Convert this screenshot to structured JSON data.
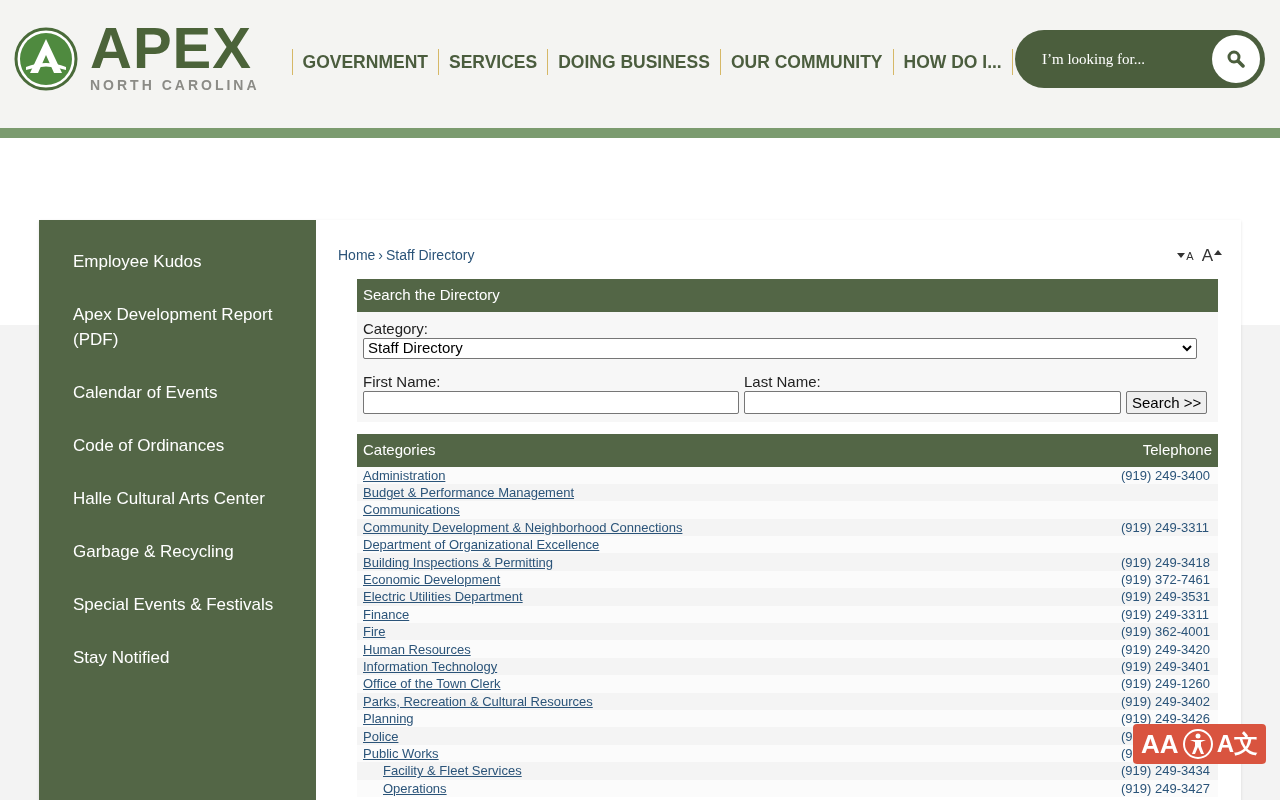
{
  "logo": {
    "name": "APEX",
    "subtitle": "NORTH CAROLINA"
  },
  "nav": [
    "GOVERNMENT",
    "SERVICES",
    "DOING BUSINESS",
    "OUR COMMUNITY",
    "HOW DO I..."
  ],
  "search": {
    "placeholder": "I’m looking for..."
  },
  "sidebar": {
    "items": [
      "Employee Kudos",
      "Apex Development Report (PDF)",
      "Calendar of Events",
      "Code of Ordinances",
      "Halle Cultural Arts Center",
      "Garbage & Recycling",
      "Special Events & Festivals",
      "Stay Notified"
    ]
  },
  "breadcrumb": {
    "items": [
      "Home",
      "Staff Directory"
    ],
    "separator": "›"
  },
  "font_size_controls": {
    "decrease": "A",
    "increase": "A"
  },
  "directory_search": {
    "title": "Search the Directory",
    "category_label": "Category:",
    "category_value": "Staff Directory",
    "first_name_label": "First Name:",
    "last_name_label": "Last Name:",
    "button": "Search >>"
  },
  "table": {
    "columns": [
      "Categories",
      "Telephone"
    ],
    "rows": [
      {
        "name": "Administration",
        "phone": "(919) 249-3400"
      },
      {
        "name": "Budget & Performance Management"
      },
      {
        "name": "Communications"
      },
      {
        "name": "Community Development & Neighborhood Connections",
        "phone": "(919) 249-3311"
      },
      {
        "name": "Department of Organizational Excellence"
      },
      {
        "name": "Building Inspections & Permitting",
        "phone": "(919) 249-3418"
      },
      {
        "name": "Economic Development",
        "phone": "(919) 372-7461"
      },
      {
        "name": "Electric Utilities Department",
        "phone": "(919) 249-3531"
      },
      {
        "name": "Finance",
        "phone": "(919) 249-3311"
      },
      {
        "name": "Fire",
        "phone": "(919) 362-4001"
      },
      {
        "name": "Human Resources",
        "phone": "(919) 249-3420"
      },
      {
        "name": "Information Technology",
        "phone": "(919) 249-3401"
      },
      {
        "name": "Office of the Town Clerk",
        "phone": "(919) 249-1260"
      },
      {
        "name": "Parks, Recreation & Cultural Resources",
        "phone": "(919) 249-3402"
      },
      {
        "name": "Planning",
        "phone": "(919) 249-3426"
      },
      {
        "name": "Police",
        "phone": "(9"
      },
      {
        "name": "Public Works",
        "phone": "(9",
        "children": [
          {
            "name": "Facility & Fleet Services",
            "phone": "(919) 249-3434"
          },
          {
            "name": "Operations",
            "phone": "(919) 249-3427"
          }
        ]
      }
    ]
  },
  "accessibility_widget": {
    "text_size": "AA",
    "translate": "A文"
  }
}
